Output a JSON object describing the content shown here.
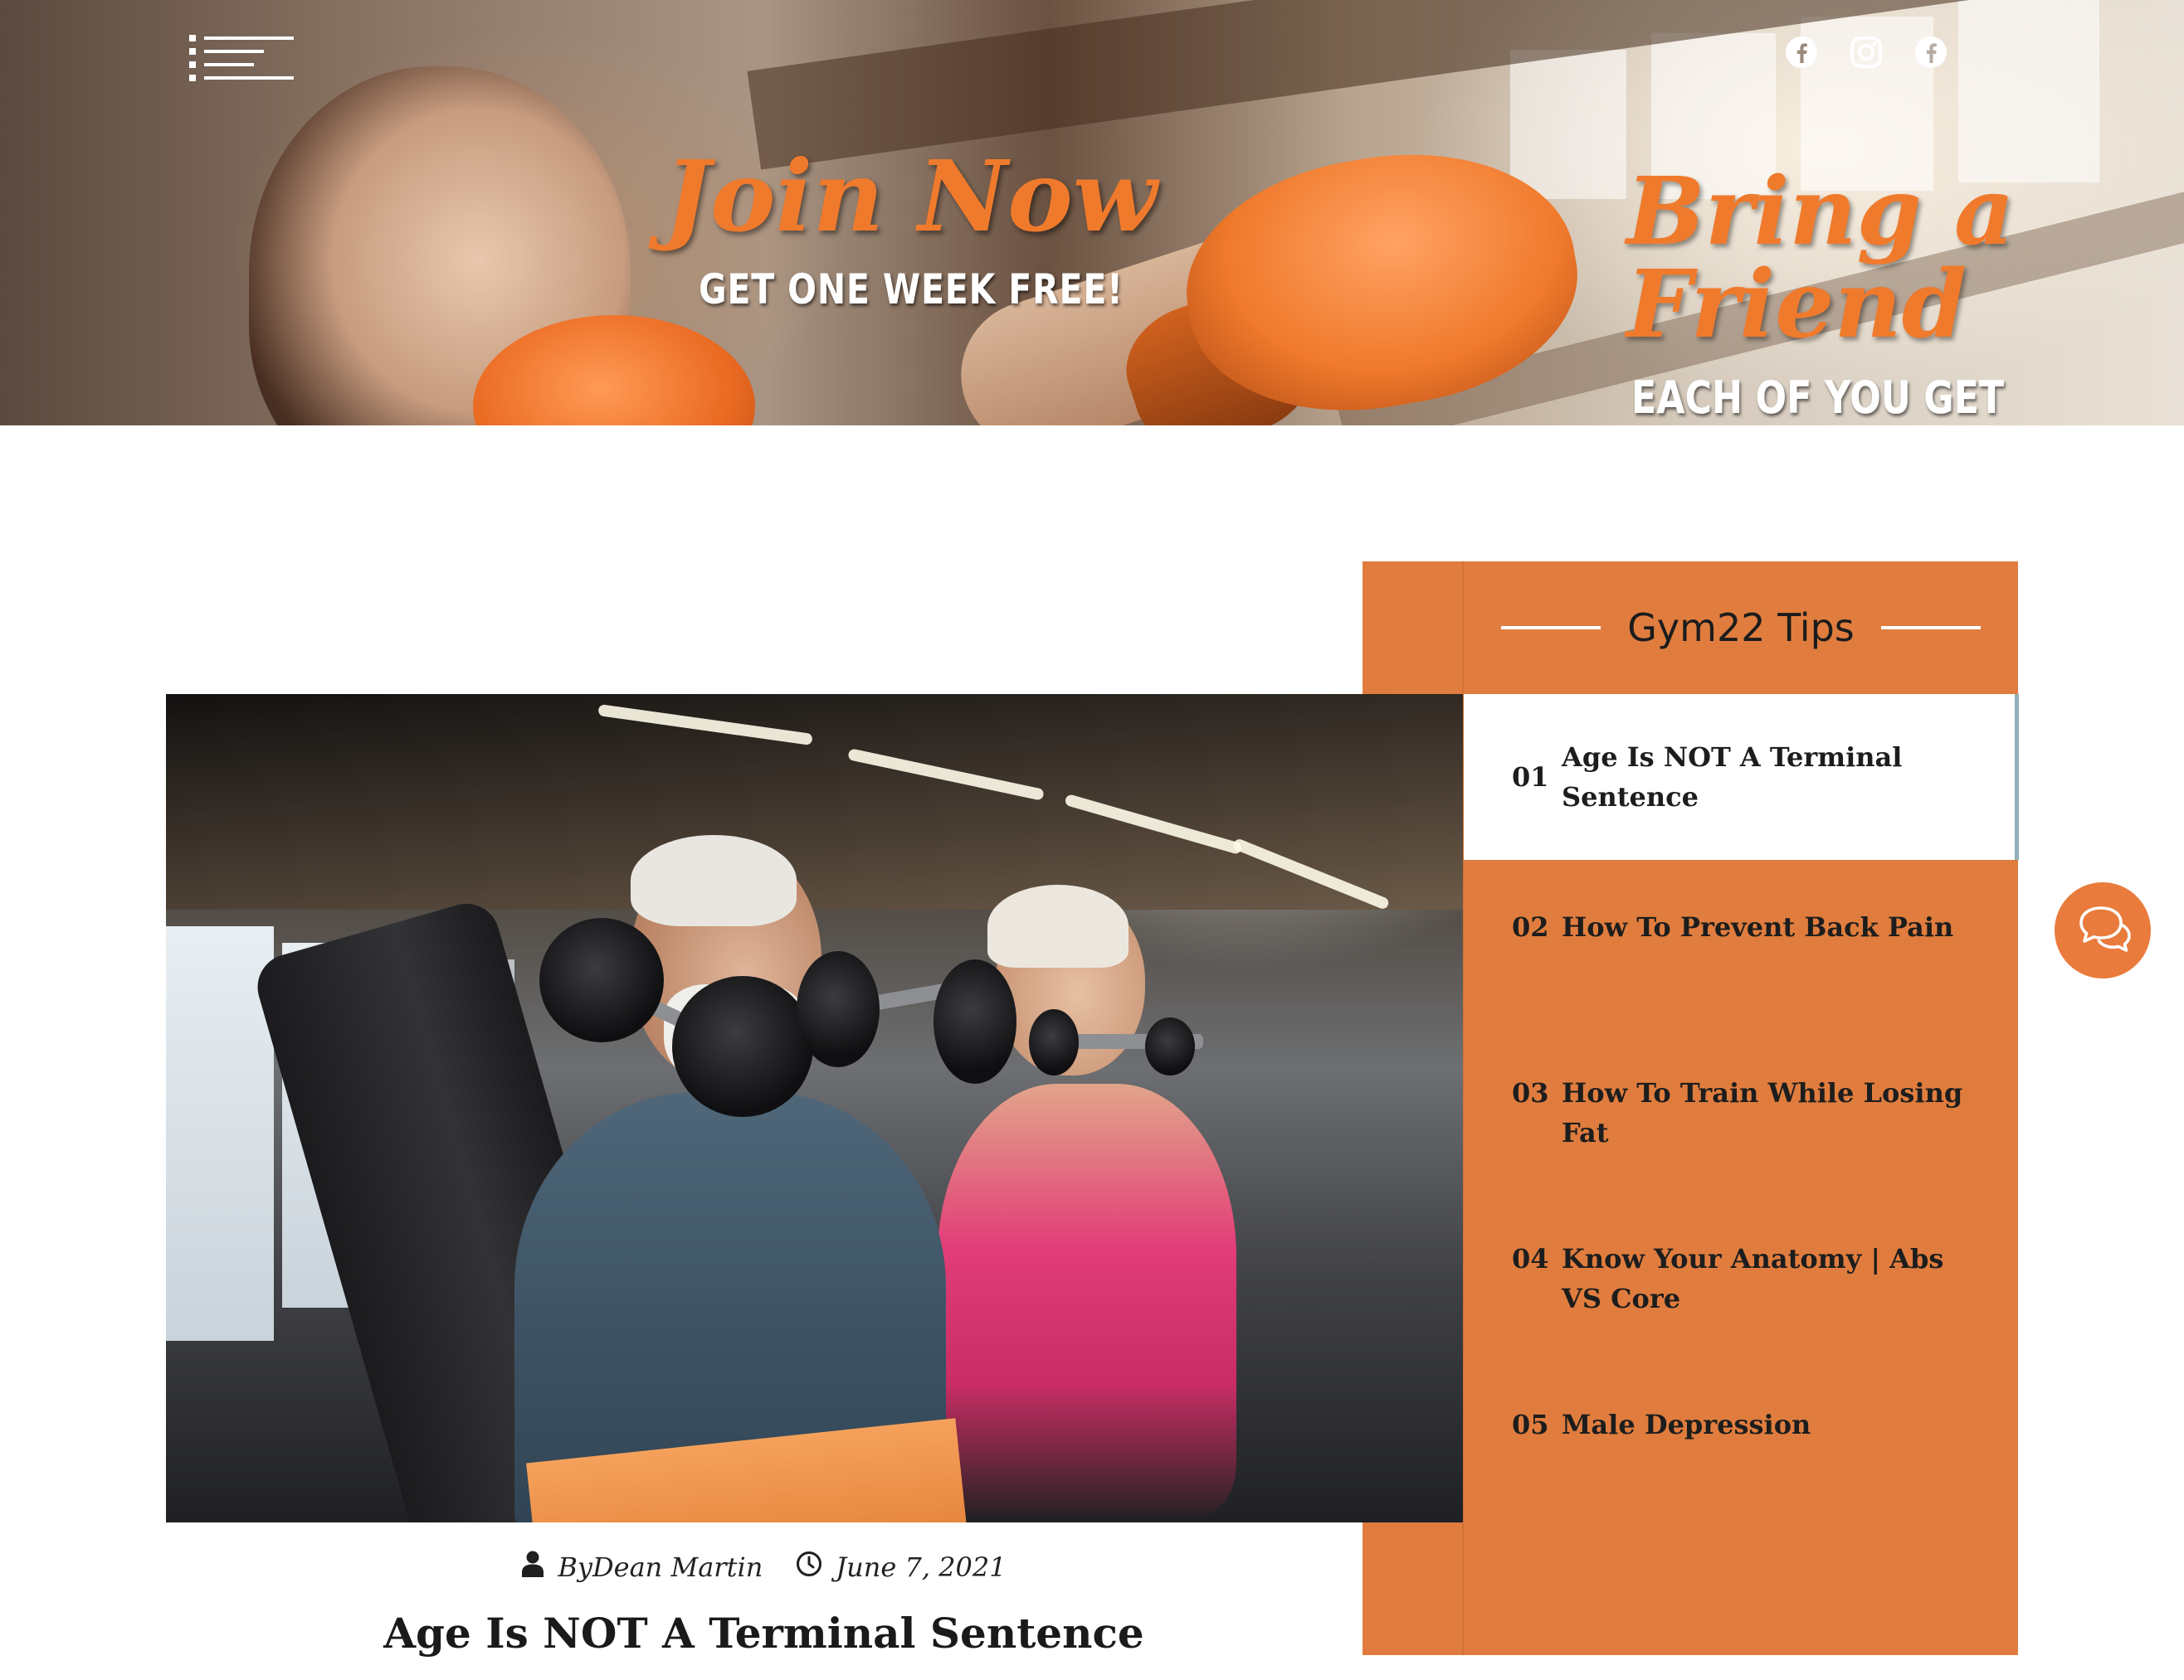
{
  "header": {
    "menu_icon": "hamburger-menu-icon",
    "social_icons": [
      "facebook-icon",
      "instagram-icon",
      "facebook-icon"
    ]
  },
  "banner": {
    "join_title": "Join Now",
    "join_subtitle": "GET ONE WEEK FREE!",
    "bring_title_line1": "Bring a",
    "bring_title_line2": "Friend",
    "bring_subtitle": "EACH OF YOU GET"
  },
  "post": {
    "author": "ByDean Martin",
    "date": "June 7, 2021",
    "title": "Age Is NOT A Terminal Sentence",
    "author_icon": "user-icon",
    "date_icon": "clock-icon"
  },
  "sidebar": {
    "heading": "Gym22 Tips",
    "tips": [
      {
        "num": "01",
        "label": "Age Is NOT A Terminal Sentence",
        "active": true
      },
      {
        "num": "02",
        "label": "How To Prevent Back Pain",
        "active": false
      },
      {
        "num": "03",
        "label": "How To Train While Losing Fat",
        "active": false
      },
      {
        "num": "04",
        "label": "Know Your Anatomy | Abs VS Core",
        "active": false
      },
      {
        "num": "05",
        "label": "Male Depression",
        "active": false
      }
    ]
  },
  "chat": {
    "icon": "chat-bubbles-icon"
  },
  "colors": {
    "accent": "#e07d3e",
    "active_bg": "#ffffff",
    "text": "#1c1c1c"
  }
}
